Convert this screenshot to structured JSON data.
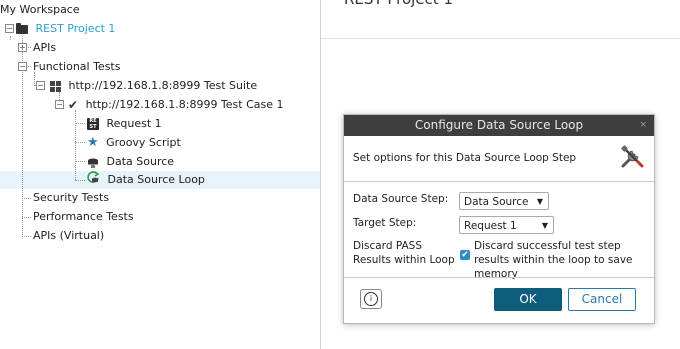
{
  "workspace": {
    "title": "My Workspace",
    "project": "REST Project 1",
    "apis": "APIs",
    "functional_tests": "Functional Tests",
    "suite": "http://192.168.1.8:8999 Test Suite",
    "test_case": "http://192.168.1.8:8999 Test Case 1",
    "steps": [
      "Request 1",
      "Groovy Script",
      "Data Source",
      "Data Source Loop"
    ],
    "security_tests": "Security Tests",
    "performance_tests": "Performance Tests",
    "apis_virtual": "APIs (Virtual)"
  },
  "main": {
    "title": "REST Project 1"
  },
  "dialog": {
    "title": "Configure Data Source Loop",
    "close": "×",
    "description": "Set options for this Data Source Loop Step",
    "data_source_step_label": "Data Source Step:",
    "data_source_step_value": "Data Source",
    "target_step_label": "Target Step:",
    "target_step_value": "Request 1",
    "discard_label": "Discard PASS Results within Loop",
    "discard_checkbox_label": "Discard successful test step results within the loop to save memory",
    "discard_checked": true,
    "info": "i",
    "ok": "OK",
    "cancel": "Cancel"
  },
  "colors": {
    "project": "#2a9fcf",
    "selection": "#e6f3fb",
    "ok_button": "#0e5d7d",
    "cancel_border": "#2a7aa8",
    "title_bar": "#3e3e3e"
  }
}
